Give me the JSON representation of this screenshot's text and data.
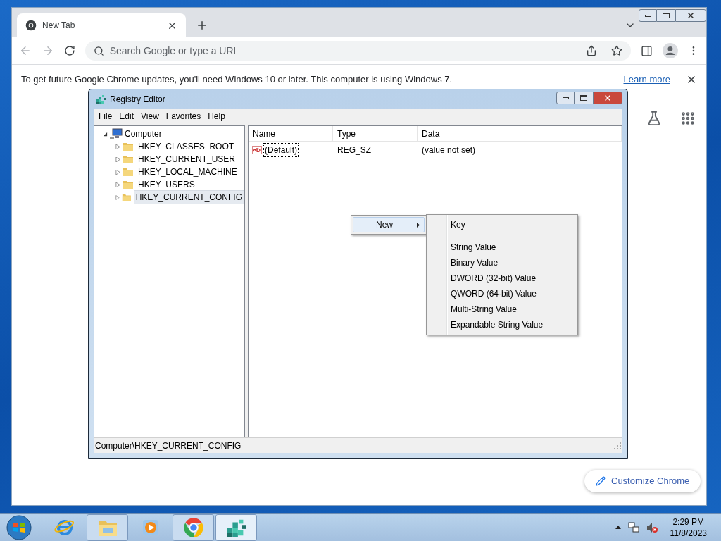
{
  "chrome": {
    "tabs": [
      {
        "title": "New Tab",
        "selected": true
      }
    ],
    "address_bar": {
      "placeholder": "Search Google or type a URL"
    },
    "infobar": {
      "message": "To get future Google Chrome updates, you'll need Windows 10 or later. This computer is using Windows 7.",
      "link": "Learn more"
    },
    "customize_button": "Customize Chrome"
  },
  "regedit": {
    "title": "Registry Editor",
    "menu": [
      "File",
      "Edit",
      "View",
      "Favorites",
      "Help"
    ],
    "tree": {
      "label": "Computer",
      "expanded": true,
      "children": [
        {
          "label": "HKEY_CLASSES_ROOT",
          "expanded": false,
          "selected": false
        },
        {
          "label": "HKEY_CURRENT_USER",
          "expanded": false,
          "selected": false
        },
        {
          "label": "HKEY_LOCAL_MACHINE",
          "expanded": false,
          "selected": false
        },
        {
          "label": "HKEY_USERS",
          "expanded": false,
          "selected": false
        },
        {
          "label": "HKEY_CURRENT_CONFIG",
          "expanded": false,
          "selected": true
        }
      ]
    },
    "columns": [
      "Name",
      "Type",
      "Data"
    ],
    "rows": [
      {
        "name": "(Default)",
        "type": "REG_SZ",
        "data": "(value not set)",
        "focused": true
      }
    ],
    "status_bar": "Computer\\HKEY_CURRENT_CONFIG"
  },
  "context_menu": {
    "items": [
      {
        "label": "New",
        "has_submenu": true,
        "selected": true
      }
    ]
  },
  "submenu": {
    "items": [
      {
        "kind": "item",
        "label": "Key"
      },
      {
        "kind": "separator"
      },
      {
        "kind": "item",
        "label": "String Value"
      },
      {
        "kind": "item",
        "label": "Binary Value"
      },
      {
        "kind": "item",
        "label": "DWORD (32-bit) Value"
      },
      {
        "kind": "item",
        "label": "QWORD (64-bit) Value"
      },
      {
        "kind": "item",
        "label": "Multi-String Value"
      },
      {
        "kind": "item",
        "label": "Expandable String Value"
      }
    ]
  },
  "taskbar": {
    "apps": [
      {
        "kind": "ie",
        "running": false,
        "active": false
      },
      {
        "kind": "explorer",
        "running": true,
        "active": false
      },
      {
        "kind": "media",
        "running": false,
        "active": false
      },
      {
        "kind": "chrome",
        "running": true,
        "active": false
      },
      {
        "kind": "regedit",
        "running": true,
        "active": true
      }
    ],
    "clock": {
      "time": "2:29 PM",
      "date": "11/8/2023"
    }
  }
}
